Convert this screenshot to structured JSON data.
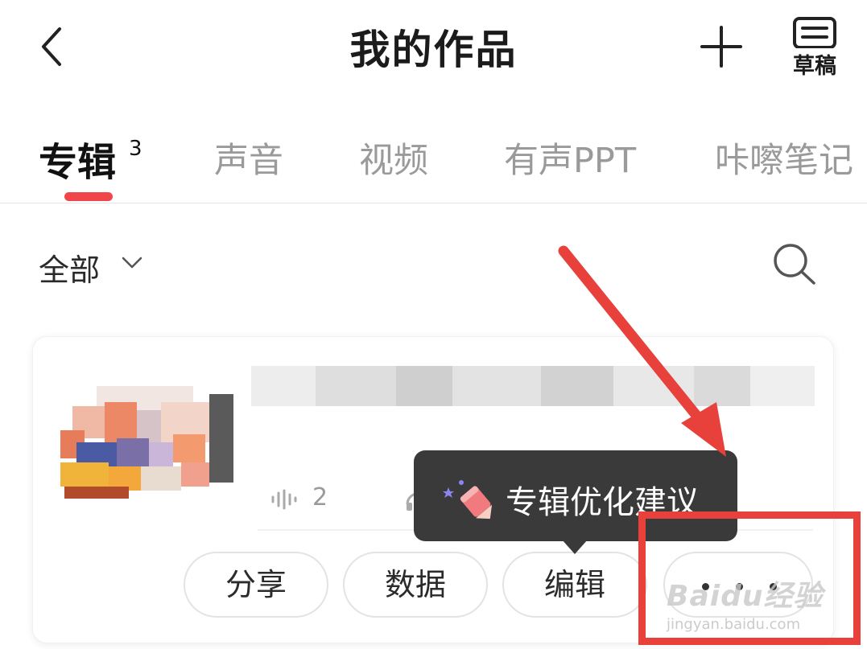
{
  "header": {
    "title": "我的作品",
    "drafts_label": "草稿"
  },
  "tabs": [
    {
      "label": "专辑",
      "count": "3",
      "active": true
    },
    {
      "label": "声音"
    },
    {
      "label": "视频"
    },
    {
      "label": "有声PPT"
    },
    {
      "label": "咔嚓笔记"
    }
  ],
  "filter": {
    "label": "全部"
  },
  "album_card": {
    "plays": "2",
    "buttons": [
      "分享",
      "数据",
      "编辑"
    ]
  },
  "tooltip": {
    "text": "专辑优化建议"
  },
  "watermark": {
    "main": "Baidu经验",
    "sub": "jingyan.baidu.com"
  },
  "colors": {
    "accent": "#f0464a",
    "annotation_red": "#e8403a",
    "tooltip_bg": "#3a3a3a"
  },
  "icons": [
    "back-icon",
    "add-icon",
    "drafts-icon",
    "chevron-down-icon",
    "search-icon",
    "plays-icon",
    "headphones-icon",
    "pencil-icon",
    "more-icon"
  ]
}
